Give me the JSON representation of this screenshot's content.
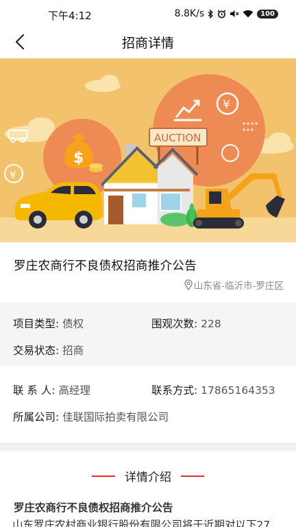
{
  "status_bar": {
    "time": "下午4:12",
    "network_speed": "8.8K/s",
    "battery": "100",
    "icons": [
      "bluetooth-icon",
      "alarm-icon",
      "mute-icon",
      "signal-icon",
      "wifi-icon",
      "battery-icon"
    ]
  },
  "header": {
    "title": "招商详情",
    "back_icon": "chevron-left-icon"
  },
  "banner": {
    "sign_text": "AUCTION",
    "colors": {
      "background": "#f2c36c",
      "circle": "#ee8b55",
      "car": "#f5b800",
      "excavator": "#f4a21a"
    }
  },
  "listing": {
    "title": "罗庄农商行不良债权招商推介公告",
    "location": "山东省-临沂市-罗庄区"
  },
  "info": {
    "type_label": "项目类型:",
    "type_value": "债权",
    "views_label": "围观次数:",
    "views_value": "228",
    "status_label": "交易状态:",
    "status_value": "招商",
    "contact_label": "联 系 人:",
    "contact_value": "高经理",
    "phone_label": "联系方式:",
    "phone_value": "17865164353",
    "company_label": "所属公司:",
    "company_value": "佳联国际拍卖有限公司"
  },
  "detail": {
    "heading": "详情介绍",
    "subtitle": "罗庄农商行不良债权招商推介公告",
    "body": "山东罗庄农村商业银行股份有限公司将于近期对以下27"
  },
  "colors": {
    "accent": "#e0301e",
    "muted": "#8a8a8a",
    "panel": "#f5f5f5"
  }
}
